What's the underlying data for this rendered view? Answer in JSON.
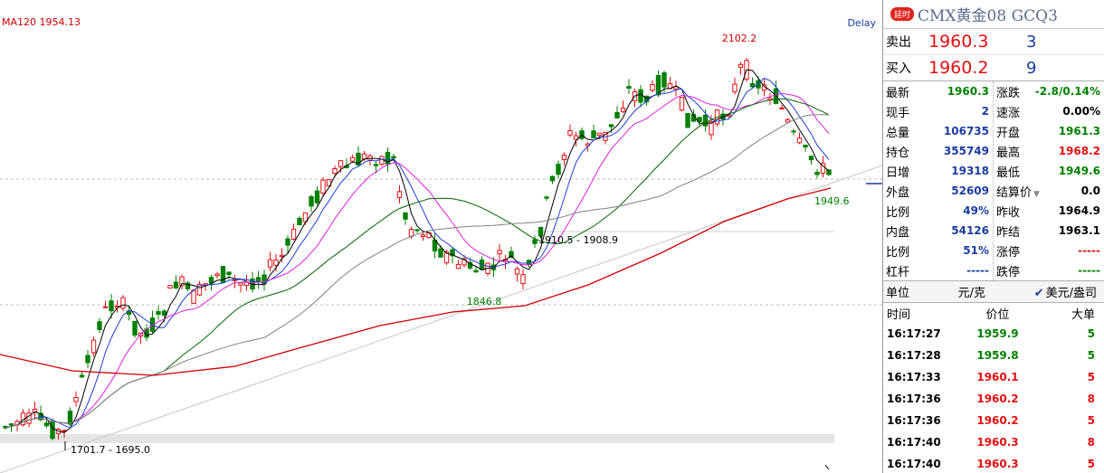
{
  "chart": {
    "ma_label": "MA120 1954.13",
    "delay_label": "Delay",
    "annotations": {
      "high": "2102.2",
      "low": "1701.7 - 1695.0",
      "mid_low": "1846.8",
      "mid_range": "1910.5 - 1908.9",
      "last_low": "1949.6"
    },
    "colors": {
      "up": "#e01010",
      "down": "#008000",
      "ma5": "#000000",
      "ma10": "#1c3fd6",
      "ma20": "#e020e0",
      "ma60": "#006400",
      "ma_mid": "#808080",
      "ma120": "#d00000"
    }
  },
  "panel": {
    "delay_tag": "延时",
    "title": "CMX黄金08  GCQ3",
    "sell": {
      "label": "卖出",
      "price": "1960.3",
      "volume": "3"
    },
    "buy": {
      "label": "买入",
      "price": "1960.2",
      "volume": "9"
    },
    "left": [
      {
        "label": "最新",
        "value": "1960.3",
        "color": "green"
      },
      {
        "label": "现手",
        "value": "2",
        "color": "blue"
      },
      {
        "label": "总量",
        "value": "106735",
        "color": "blue"
      },
      {
        "label": "持仓",
        "value": "355749",
        "color": "blue"
      },
      {
        "label": "日增",
        "value": "19318",
        "color": "blue"
      },
      {
        "label": "外盘",
        "value": "52609",
        "color": "blue"
      },
      {
        "label": "比例",
        "value": "49%",
        "color": "blue"
      },
      {
        "label": "内盘",
        "value": "54126",
        "color": "blue"
      },
      {
        "label": "比例",
        "value": "51%",
        "color": "blue"
      },
      {
        "label": "杠杆",
        "value": "-----",
        "color": "blue"
      }
    ],
    "right": [
      {
        "label": "涨跌",
        "value": "-2.8/0.14%",
        "color": "green"
      },
      {
        "label": "速涨",
        "value": "0.00%",
        "color": "black"
      },
      {
        "label": "开盘",
        "value": "1961.3",
        "color": "green"
      },
      {
        "label": "最高",
        "value": "1968.2",
        "color": "red"
      },
      {
        "label": "最低",
        "value": "1949.6",
        "color": "green"
      },
      {
        "label": "结算价",
        "value": "0.0",
        "color": "black"
      },
      {
        "label": "昨收",
        "value": "1964.9",
        "color": "black"
      },
      {
        "label": "昨结",
        "value": "1963.1",
        "color": "black"
      },
      {
        "label": "涨停",
        "value": "-----",
        "color": "red"
      },
      {
        "label": "跌停",
        "value": "-----",
        "color": "green"
      }
    ],
    "unit_label": "单位",
    "unit_value": "元/克",
    "currency_label": "美元/盎司",
    "trade_headers": {
      "time": "时间",
      "price": "价位",
      "volume": "大单"
    },
    "trades": [
      {
        "time": "16:17:27",
        "price": "1959.9",
        "volume": "5",
        "color": "green"
      },
      {
        "time": "16:17:28",
        "price": "1959.8",
        "volume": "5",
        "color": "green"
      },
      {
        "time": "16:17:33",
        "price": "1960.1",
        "volume": "5",
        "color": "red"
      },
      {
        "time": "16:17:36",
        "price": "1960.2",
        "volume": "8",
        "color": "red"
      },
      {
        "time": "16:17:36",
        "price": "1960.2",
        "volume": "5",
        "color": "red"
      },
      {
        "time": "16:17:40",
        "price": "1960.3",
        "volume": "8",
        "color": "red"
      },
      {
        "time": "16:17:40",
        "price": "1960.3",
        "volume": "5",
        "color": "red"
      }
    ]
  }
}
